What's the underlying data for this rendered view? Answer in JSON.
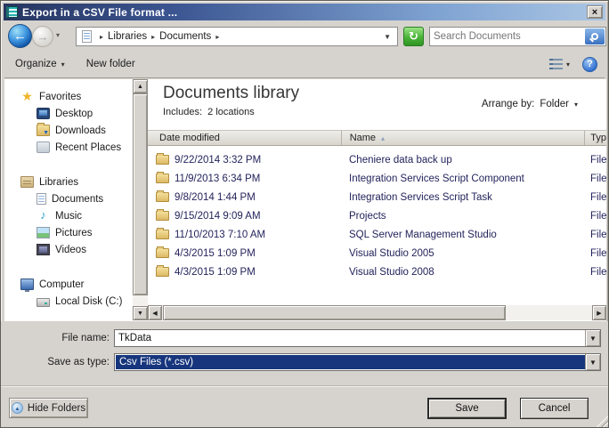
{
  "window": {
    "title": "Export in a CSV File format ..."
  },
  "glyphs": {
    "close": "×",
    "back": "←",
    "forward": "→",
    "chevron_down": "▾",
    "breadcrumb_sep": "▸",
    "dropdown": "▼",
    "refresh": "↻",
    "help": "?",
    "sort_asc": "▴",
    "scroll_up": "▲",
    "scroll_down": "▼",
    "scroll_left": "◀",
    "scroll_right": "▶",
    "hide_folders_up": "▴",
    "star": "★",
    "music_note": "♪"
  },
  "address_bar": {
    "breadcrumb": [
      {
        "label": "Libraries"
      },
      {
        "label": "Documents"
      }
    ],
    "search_placeholder": "Search Documents"
  },
  "toolbar": {
    "organize_label": "Organize",
    "new_folder_label": "New folder"
  },
  "sidebar": {
    "groups": [
      {
        "label": "Favorites",
        "icon": "star-icon",
        "items": [
          {
            "label": "Desktop",
            "icon": "desktop-icon"
          },
          {
            "label": "Downloads",
            "icon": "downloads-icon"
          },
          {
            "label": "Recent Places",
            "icon": "recent-places-icon"
          }
        ]
      },
      {
        "label": "Libraries",
        "icon": "libraries-icon",
        "items": [
          {
            "label": "Documents",
            "icon": "documents-icon"
          },
          {
            "label": "Music",
            "icon": "music-icon"
          },
          {
            "label": "Pictures",
            "icon": "pictures-icon"
          },
          {
            "label": "Videos",
            "icon": "videos-icon"
          }
        ]
      },
      {
        "label": "Computer",
        "icon": "computer-icon",
        "items": [
          {
            "label": "Local Disk (C:)",
            "icon": "local-disk-icon"
          }
        ]
      }
    ]
  },
  "library_header": {
    "title": "Documents library",
    "subtitle": "Includes:  2 locations",
    "arrange_by_label": "Arrange by:",
    "arrange_by_value": "Folder"
  },
  "file_list": {
    "columns": {
      "date_modified": "Date modified",
      "name": "Name",
      "type": "Typ"
    },
    "sort_column": "Name",
    "rows": [
      {
        "date_modified": "9/22/2014 3:32 PM",
        "name": "Cheniere data back up",
        "type": "File"
      },
      {
        "date_modified": "11/9/2013 6:34 PM",
        "name": "Integration Services Script Component",
        "type": "File"
      },
      {
        "date_modified": "9/8/2014 1:44 PM",
        "name": "Integration Services Script Task",
        "type": "File"
      },
      {
        "date_modified": "9/15/2014 9:09 AM",
        "name": "Projects",
        "type": "File"
      },
      {
        "date_modified": "11/10/2013 7:10 AM",
        "name": "SQL Server Management Studio",
        "type": "File"
      },
      {
        "date_modified": "4/3/2015 1:09 PM",
        "name": "Visual Studio 2005",
        "type": "File"
      },
      {
        "date_modified": "4/3/2015 1:09 PM",
        "name": "Visual Studio 2008",
        "type": "File"
      }
    ]
  },
  "footer": {
    "file_name_label": "File name:",
    "file_name_value": "TkData",
    "save_as_type_label": "Save as type:",
    "save_as_type_value": "Csv Files (*.csv)",
    "hide_folders_label": "Hide Folders",
    "save_label": "Save",
    "cancel_label": "Cancel"
  },
  "colors": {
    "titlebar_left": "#26355f",
    "titlebar_right": "#abc6e4",
    "dialog_bg": "#d6d3ce",
    "selection_blue": "#16357c",
    "refresh_green": "#49b437",
    "search_button_blue": "#3a70c0"
  }
}
